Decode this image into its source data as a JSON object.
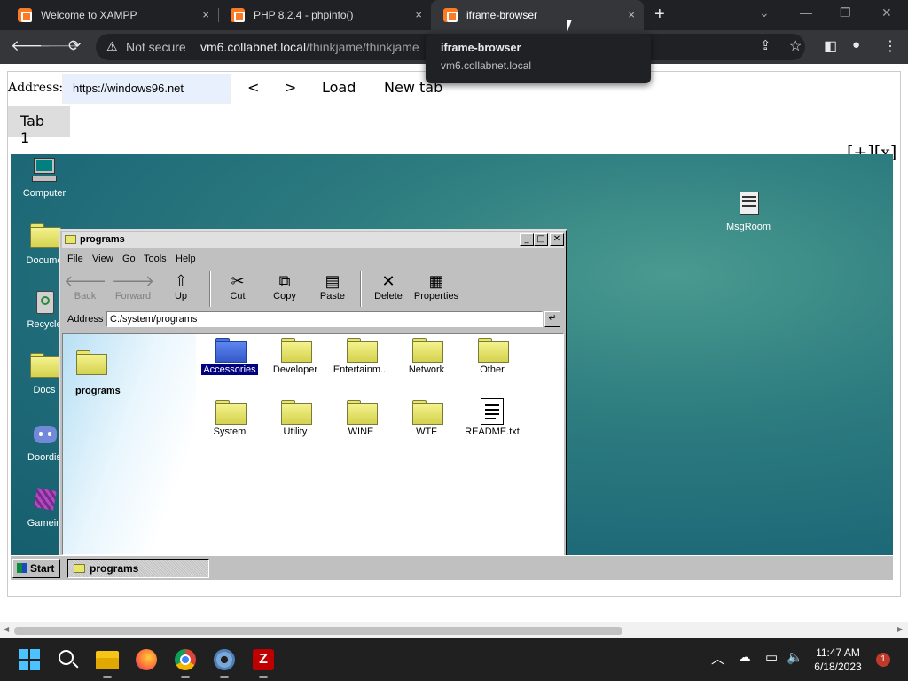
{
  "chrome": {
    "tabs": [
      {
        "title": "Welcome to XAMPP",
        "close": "×"
      },
      {
        "title": "PHP 8.2.4 - phpinfo()",
        "close": "×"
      },
      {
        "title": "iframe-browser",
        "close": "×"
      }
    ],
    "new_tab": "+",
    "window_controls": {
      "menu": "⌄",
      "minimize": "—",
      "restore": "❐",
      "close": "✕"
    },
    "security_label": "Not secure",
    "url_host": "vm6.collabnet.local",
    "url_path": "/thinkjame/thinkjame",
    "tooltip": {
      "title": "iframe-browser",
      "host": "vm6.collabnet.local"
    },
    "toolbar_icons": [
      "back-icon",
      "forward-icon",
      "reload-icon",
      "share-icon",
      "bookmark-star-icon",
      "sidebar-icon",
      "profile-icon",
      "menu-icon"
    ]
  },
  "iframe_browser": {
    "address_label": "Address:",
    "address_value": "https://windows96.net",
    "back_label": "<",
    "forward_label": ">",
    "load_label": "Load",
    "new_tab_label": "New tab",
    "tab_label": "Tab 1",
    "plus_close": "[+][x]"
  },
  "desktop": {
    "icons": [
      {
        "name": "Computer"
      },
      {
        "name": "Docume"
      },
      {
        "name": "Recycle"
      },
      {
        "name": "Docs"
      },
      {
        "name": "Doordis"
      },
      {
        "name": "Gamein"
      },
      {
        "name": "MsgRoom"
      }
    ]
  },
  "explorer": {
    "title": "programs",
    "menu": [
      "File",
      "View",
      "Go",
      "Tools",
      "Help"
    ],
    "tools": [
      {
        "label": "Back",
        "glyph": "🡐",
        "enabled": false
      },
      {
        "label": "Forward",
        "glyph": "🡒",
        "enabled": false
      },
      {
        "label": "Up",
        "glyph": "⇧",
        "enabled": true
      },
      {
        "label": "Cut",
        "glyph": "✂",
        "enabled": true
      },
      {
        "label": "Copy",
        "glyph": "⧉",
        "enabled": true
      },
      {
        "label": "Paste",
        "glyph": "📋",
        "enabled": true
      },
      {
        "label": "Delete",
        "glyph": "✕",
        "enabled": true
      },
      {
        "label": "Properties",
        "glyph": "🗒",
        "enabled": true
      }
    ],
    "address_label": "Address",
    "address_value": "C:/system/programs",
    "go_glyph": "↵",
    "sidebar_title": "programs",
    "items": [
      {
        "label": "Accessories",
        "selected": true,
        "kind": "folder-blue"
      },
      {
        "label": "Developer",
        "selected": false,
        "kind": "folder"
      },
      {
        "label": "Entertainm...",
        "selected": false,
        "kind": "folder"
      },
      {
        "label": "Network",
        "selected": false,
        "kind": "folder"
      },
      {
        "label": "Other",
        "selected": false,
        "kind": "folder"
      },
      {
        "label": "System",
        "selected": false,
        "kind": "folder"
      },
      {
        "label": "Utility",
        "selected": false,
        "kind": "folder"
      },
      {
        "label": "WINE",
        "selected": false,
        "kind": "folder"
      },
      {
        "label": "WTF",
        "selected": false,
        "kind": "folder"
      },
      {
        "label": "README.txt",
        "selected": false,
        "kind": "text-file"
      }
    ]
  },
  "w96_taskbar": {
    "start_label": "Start",
    "task_label": "programs"
  },
  "taskbar": {
    "apps": [
      "windows-start-icon",
      "search-icon",
      "file-explorer-icon",
      "firefox-icon",
      "chrome-icon",
      "settings-icon",
      "filezilla-icon"
    ],
    "time": "11:47 AM",
    "date": "6/18/2023",
    "notification_count": "1"
  }
}
